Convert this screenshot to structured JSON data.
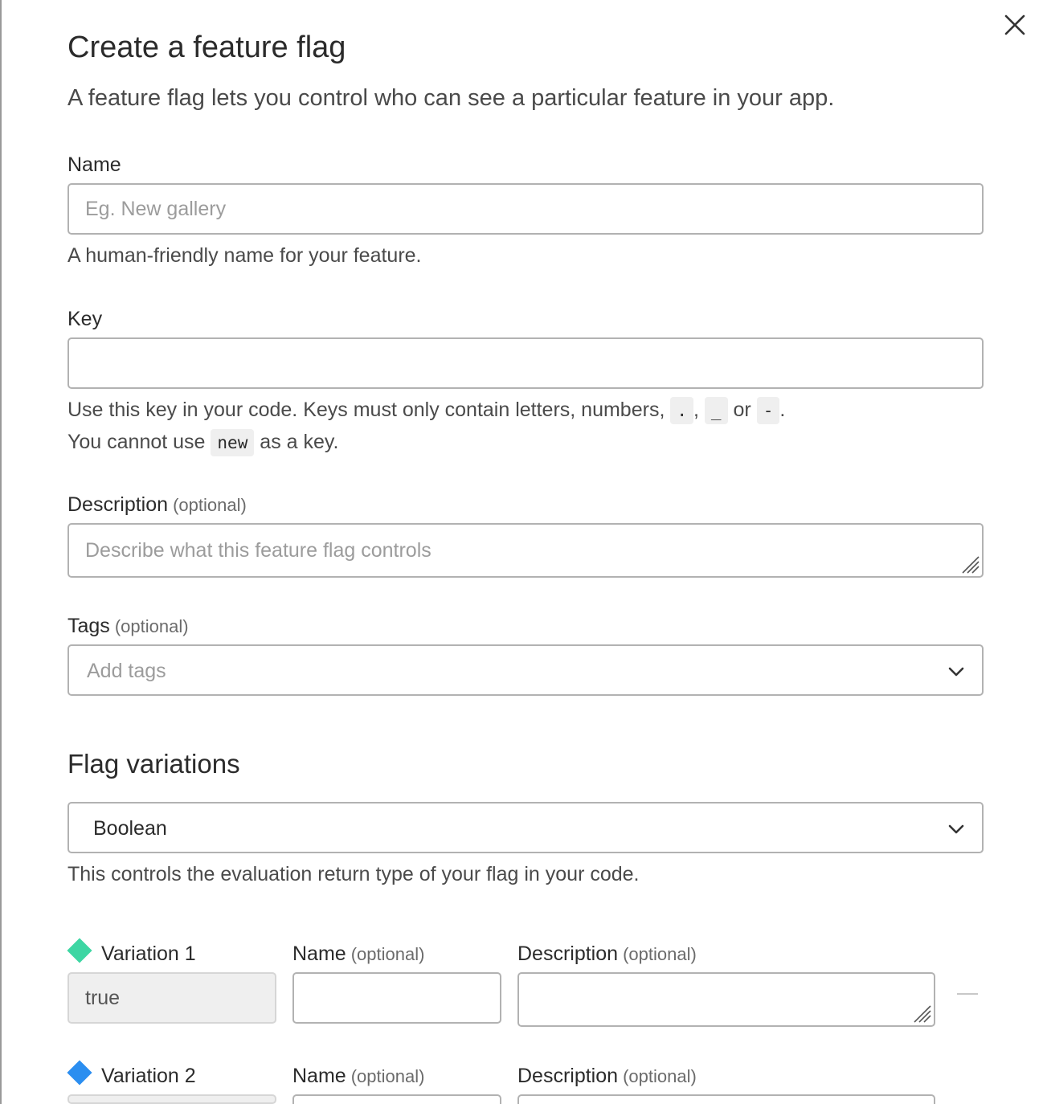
{
  "dialog": {
    "title": "Create a feature flag",
    "subtitle": "A feature flag lets you control who can see a particular feature in your app.",
    "close_icon": "close-icon"
  },
  "name_field": {
    "label": "Name",
    "placeholder": "Eg. New gallery",
    "value": "",
    "hint": "A human-friendly name for your feature."
  },
  "key_field": {
    "label": "Key",
    "value": "",
    "hint_line1_prefix": "Use this key in your code. Keys must only contain letters, numbers,",
    "hint_code_dot": ".",
    "hint_comma": ",",
    "hint_code_underscore": "_",
    "hint_or": "or",
    "hint_code_dash": "-",
    "hint_period": ".",
    "hint_line2_prefix": "You cannot use",
    "hint_code_new": "new",
    "hint_line2_suffix": "as a key."
  },
  "description_field": {
    "label": "Description",
    "optional": "(optional)",
    "placeholder": "Describe what this feature flag controls",
    "value": ""
  },
  "tags_field": {
    "label": "Tags",
    "optional": "(optional)",
    "placeholder": "Add tags",
    "chevron_icon": "chevron-down-icon"
  },
  "variations": {
    "section_title": "Flag variations",
    "type_selected": "Boolean",
    "type_hint": "This controls the evaluation return type of your flag in your code.",
    "items": [
      {
        "label": "Variation 1",
        "color": "#3dd6a3",
        "value": "true",
        "name_label": "Name",
        "name_optional": "(optional)",
        "description_label": "Description",
        "description_optional": "(optional)"
      },
      {
        "label": "Variation 2",
        "color": "#2b8ef0",
        "value": "",
        "name_label": "Name",
        "name_optional": "(optional)",
        "description_label": "Description",
        "description_optional": "(optional)"
      }
    ]
  }
}
